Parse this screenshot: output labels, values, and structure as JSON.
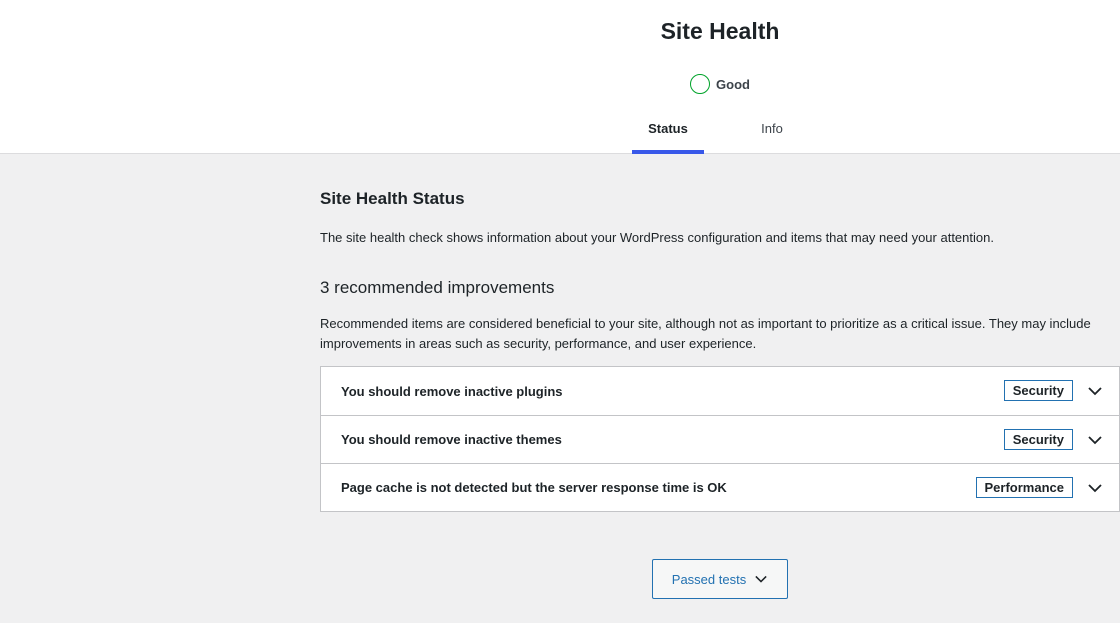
{
  "header": {
    "title": "Site Health",
    "status_label": "Good",
    "status_color": "#00a32a",
    "tabs": [
      {
        "label": "Status",
        "active": true
      },
      {
        "label": "Info",
        "active": false
      }
    ]
  },
  "main": {
    "heading": "Site Health Status",
    "intro": "The site health check shows information about your WordPress configuration and items that may need your attention.",
    "improvements_heading": "3 recommended improvements",
    "improvements_desc": "Recommended items are considered beneficial to your site, although not as important to prioritize as a critical issue. They may include improvements in areas such as security, performance, and user experience.",
    "items": [
      {
        "title": "You should remove inactive plugins",
        "badge": "Security",
        "icon": "chevron-down-icon"
      },
      {
        "title": "You should remove inactive themes",
        "badge": "Security",
        "icon": "chevron-down-icon"
      },
      {
        "title": "Page cache is not detected but the server response time is OK",
        "badge": "Performance",
        "icon": "chevron-down-icon"
      }
    ],
    "passed_tests_label": "Passed tests"
  },
  "colors": {
    "accent": "#3858e9",
    "badge_border": "#2271b1",
    "good": "#00a32a"
  }
}
